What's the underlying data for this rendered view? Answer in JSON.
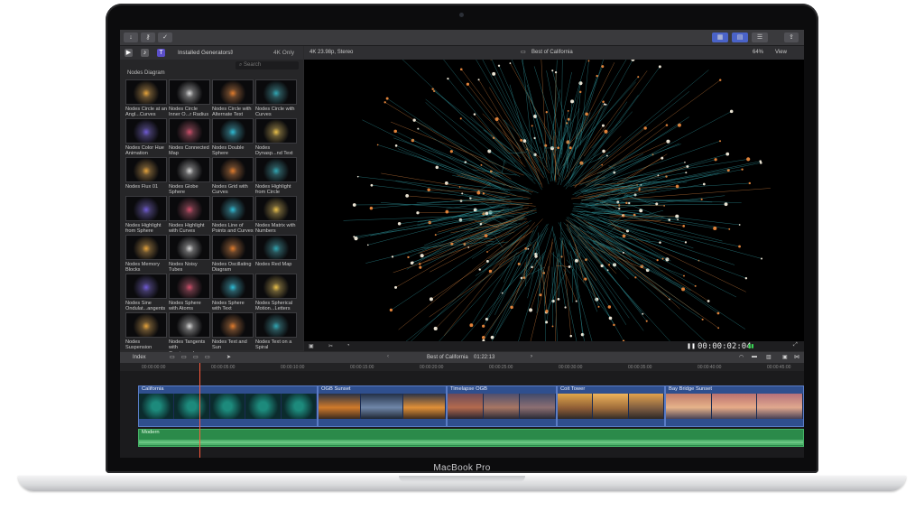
{
  "device": {
    "label": "MacBook Pro"
  },
  "toolbar": {
    "import_icon": "download-icon",
    "keywords_icon": "key-icon",
    "analyze_icon": "check-circle-icon"
  },
  "browser": {
    "generators_label": "Installed Generators",
    "filter_label": "4K Only",
    "search_placeholder": "Search",
    "category": "Nodes Diagram",
    "items": [
      "Nodes Circle at an Angl...Curves",
      "Nodes Circle Inner O...r Radius",
      "Nodes Circle with Alternate Text",
      "Nodes Circle with Curves",
      "Nodes Color Hue Animation",
      "Nodes Connected Map",
      "Nodes Double Sphere",
      "Nodes Dynasp...nd Text",
      "Nodes Flux 01",
      "Nodes Globe Sphere",
      "Nodes Grid with Curves",
      "Nodes Highlight from Circle",
      "Nodes Highlight from Sphere",
      "Nodes Highlight with Curves",
      "Nodes Line of Points and Curves",
      "Nodes Matrix with Numbers",
      "Nodes Memory Blocks",
      "Nodes Noisy Tubes",
      "Nodes Oscillating Diagram",
      "Nodes Red Map",
      "Nodes Sine Ondulat...angents",
      "Nodes Sphere with Atoms",
      "Nodes Sphere with Text",
      "Nodes Spherical Motion...Letters",
      "Nodes Suspension",
      "Nodes Tangents with Cu...icrosphere",
      "Nodes Text and Sun",
      "Nodes Text on a Spiral"
    ]
  },
  "viewer": {
    "format": "4K 23.98p, Stereo",
    "project": "Best of California",
    "zoom": "64%",
    "view_label": "View",
    "timecode": "00:00:02:04"
  },
  "timeline": {
    "index_label": "Index",
    "project": "Best of California",
    "duration": "01:22:13",
    "ruler": [
      "00:00:00:00",
      "00:00:05:00",
      "00:00:10:00",
      "00:00:15:00",
      "00:00:20:00",
      "00:00:25:00",
      "00:00:30:00",
      "00:00:35:00",
      "00:00:40:00",
      "00:00:45:00"
    ],
    "clips": [
      {
        "name": "California"
      },
      {
        "name": "OGB Sunset"
      },
      {
        "name": "Timelapse OGB"
      },
      {
        "name": "Coit Tower"
      },
      {
        "name": "Bay Bridge Sunset"
      }
    ],
    "audio": {
      "name": "Modern"
    }
  },
  "colors": {
    "accent": "#4a63c8",
    "clip_blue": "#2f4f8e",
    "audio_green": "#2b8a4a",
    "playhead": "#ff5a3c"
  }
}
